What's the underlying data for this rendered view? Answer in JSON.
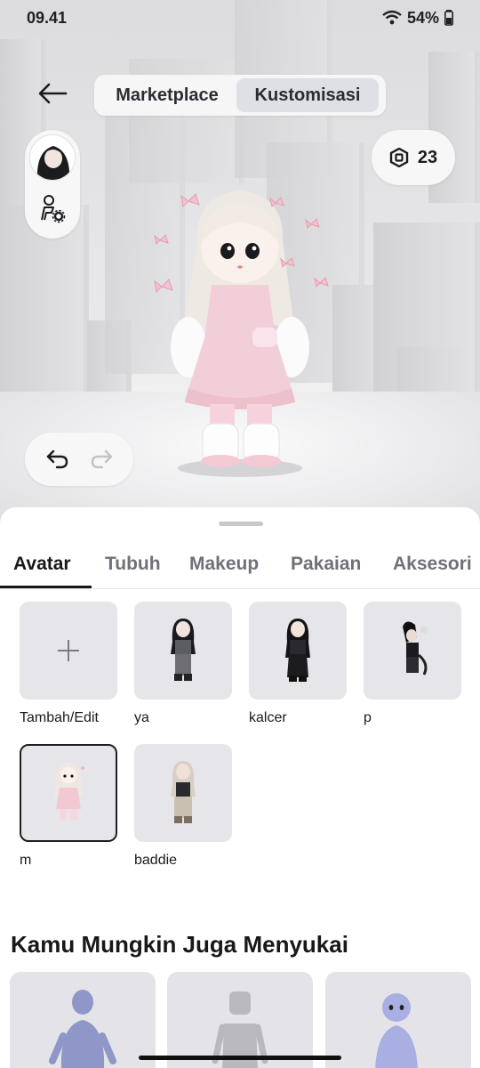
{
  "status_bar": {
    "time": "09.41",
    "battery": "54%"
  },
  "header": {
    "tabs": [
      {
        "label": "Marketplace",
        "active": false
      },
      {
        "label": "Kustomisasi",
        "active": true
      }
    ]
  },
  "robux": {
    "icon": "robux-icon",
    "count": "23"
  },
  "category_tabs": [
    {
      "label": "Avatar",
      "active": true
    },
    {
      "label": "Tubuh",
      "active": false
    },
    {
      "label": "Makeup",
      "active": false
    },
    {
      "label": "Pakaian",
      "active": false
    },
    {
      "label": "Aksesori",
      "active": false
    }
  ],
  "outfits": [
    {
      "label": "Tambah/Edit"
    },
    {
      "label": "ya"
    },
    {
      "label": "kalcer"
    },
    {
      "label": "p"
    },
    {
      "label": "m",
      "selected": true
    },
    {
      "label": "baddie"
    }
  ],
  "recommendations": {
    "title": "Kamu Mungkin Juga Menyukai"
  }
}
